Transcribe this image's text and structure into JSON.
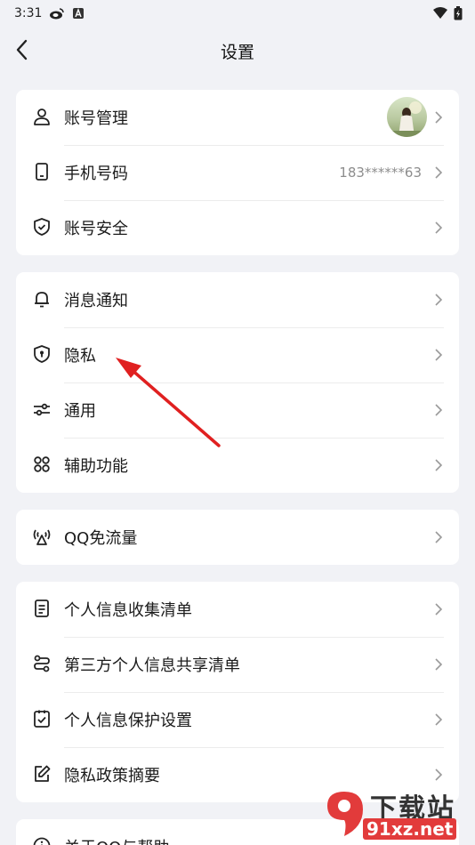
{
  "status_bar": {
    "time": "3:31"
  },
  "nav": {
    "title": "设置"
  },
  "groups": [
    [
      {
        "label": "账号管理",
        "icon": "person-icon",
        "has_avatar": true
      },
      {
        "label": "手机号码",
        "icon": "phone-icon",
        "value": "183******63"
      },
      {
        "label": "账号安全",
        "icon": "shield-check-icon"
      }
    ],
    [
      {
        "label": "消息通知",
        "icon": "bell-icon"
      },
      {
        "label": "隐私",
        "icon": "privacy-shield-icon"
      },
      {
        "label": "通用",
        "icon": "sliders-icon"
      },
      {
        "label": "辅助功能",
        "icon": "grid-icon"
      }
    ],
    [
      {
        "label": "QQ免流量",
        "icon": "antenna-icon"
      }
    ],
    [
      {
        "label": "个人信息收集清单",
        "icon": "document-icon"
      },
      {
        "label": "第三方个人信息共享清单",
        "icon": "share-flow-icon"
      },
      {
        "label": "个人信息保护设置",
        "icon": "check-clipboard-icon"
      },
      {
        "label": "隐私政策摘要",
        "icon": "edit-icon"
      }
    ],
    [
      {
        "label": "关于QQ与帮助",
        "icon": "info-icon"
      }
    ]
  ],
  "watermark": {
    "brand": "下载站",
    "domain": "91xz.net"
  },
  "annotation": {
    "arrow_color": "#e02020"
  }
}
